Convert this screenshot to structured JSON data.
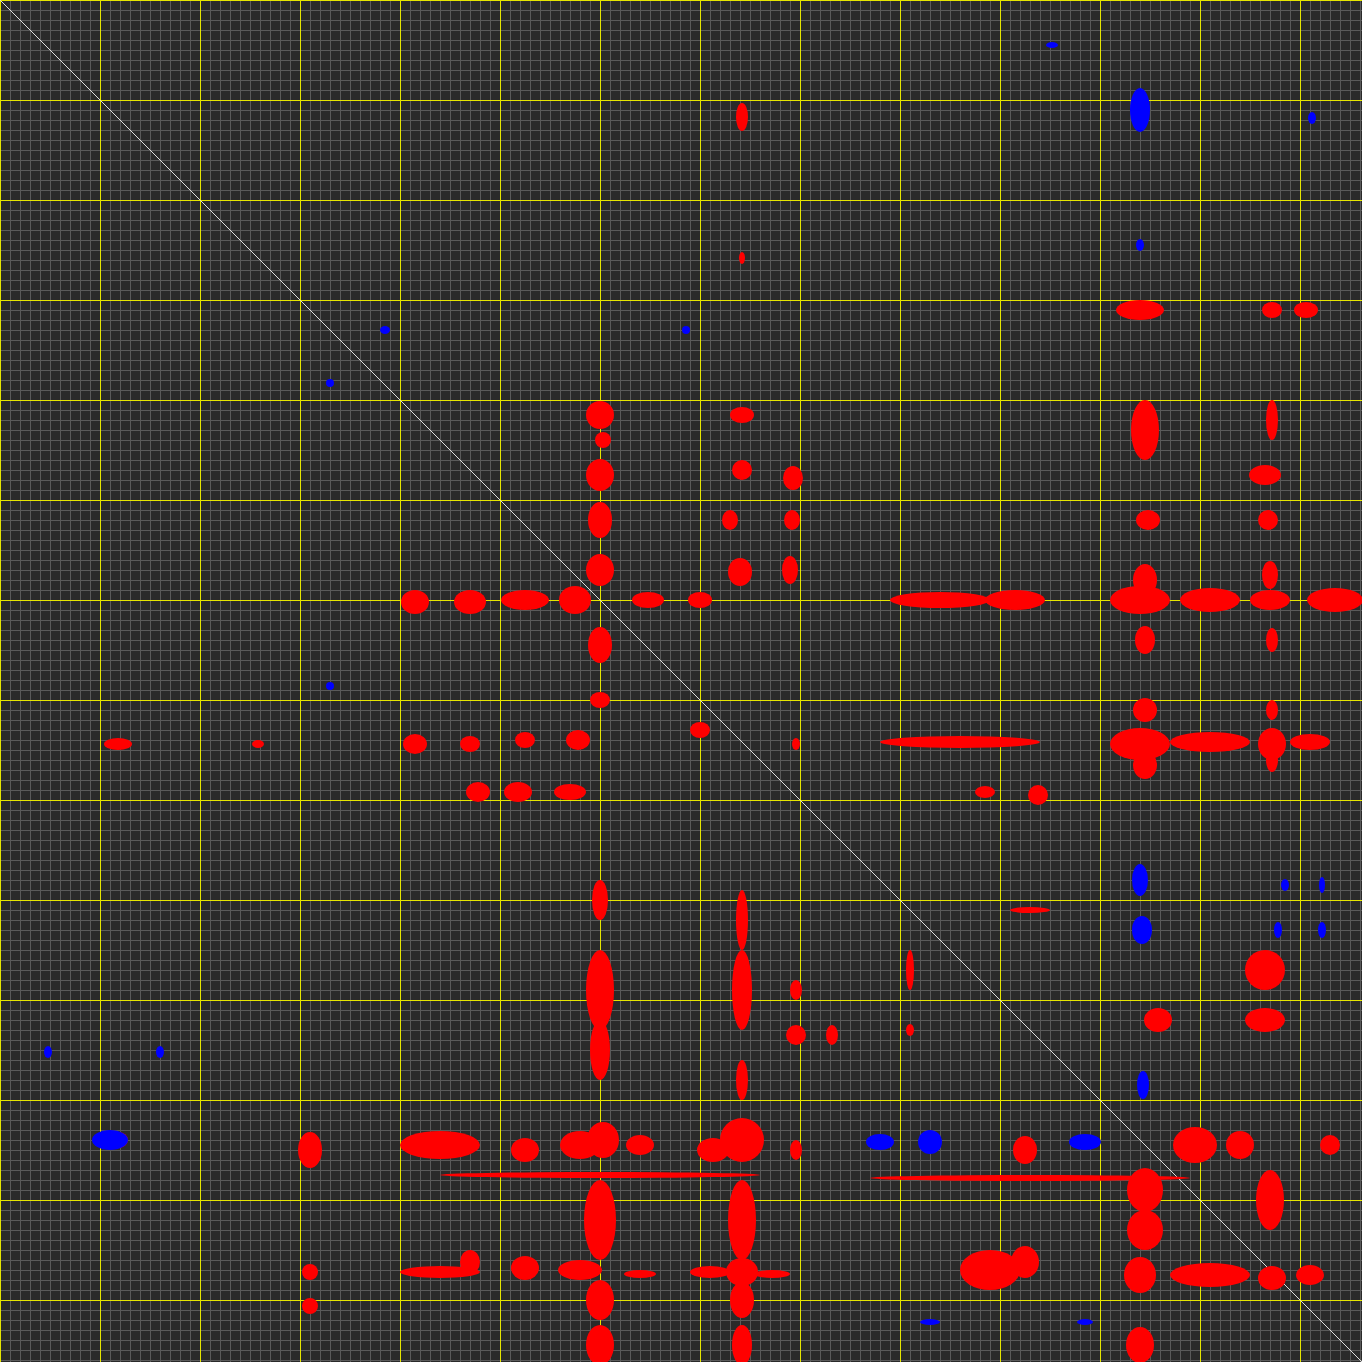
{
  "plot": {
    "kind": "contour_map"
  }
}
